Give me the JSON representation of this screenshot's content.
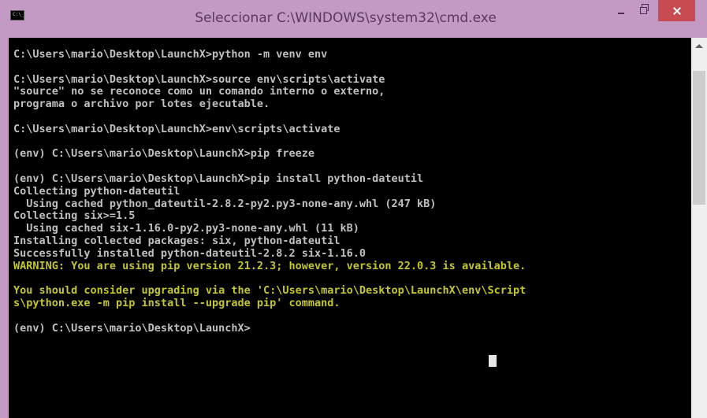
{
  "window": {
    "title": "Seleccionar C:\\WINDOWS\\system32\\cmd.exe",
    "icon": "cmd-icon",
    "icon_text": "C:\\_"
  },
  "colors": {
    "terminal_bg": "#000000",
    "terminal_text": "#c0c0c0",
    "warning_text": "#c5c52f",
    "window_frame": "#c39ac4",
    "close_button": "#c74b50"
  },
  "terminal": {
    "lines": [
      "C:\\Users\\mario\\Desktop\\LaunchX>python -m venv env",
      "",
      "C:\\Users\\mario\\Desktop\\LaunchX>source env\\scripts\\activate",
      "\"source\" no se reconoce como un comando interno o externo,",
      "programa o archivo por lotes ejecutable.",
      "",
      "C:\\Users\\mario\\Desktop\\LaunchX>env\\scripts\\activate",
      "",
      "(env) C:\\Users\\mario\\Desktop\\LaunchX>pip freeze",
      "",
      "(env) C:\\Users\\mario\\Desktop\\LaunchX>pip install python-dateutil",
      "Collecting python-dateutil",
      "  Using cached python_dateutil-2.8.2-py2.py3-none-any.whl (247 kB)",
      "Collecting six>=1.5",
      "  Using cached six-1.16.0-py2.py3-none-any.whl (11 kB)",
      "Installing collected packages: six, python-dateutil",
      "Successfully installed python-dateutil-2.8.2 six-1.16.0",
      "WARNING: You are using pip version 21.2.3; however, version 22.0.3 is available.",
      "",
      "You should consider upgrading via the 'C:\\Users\\mario\\Desktop\\LaunchX\\env\\Script",
      "s\\python.exe -m pip install --upgrade pip' command.",
      "",
      "(env) C:\\Users\\mario\\Desktop\\LaunchX>"
    ]
  }
}
